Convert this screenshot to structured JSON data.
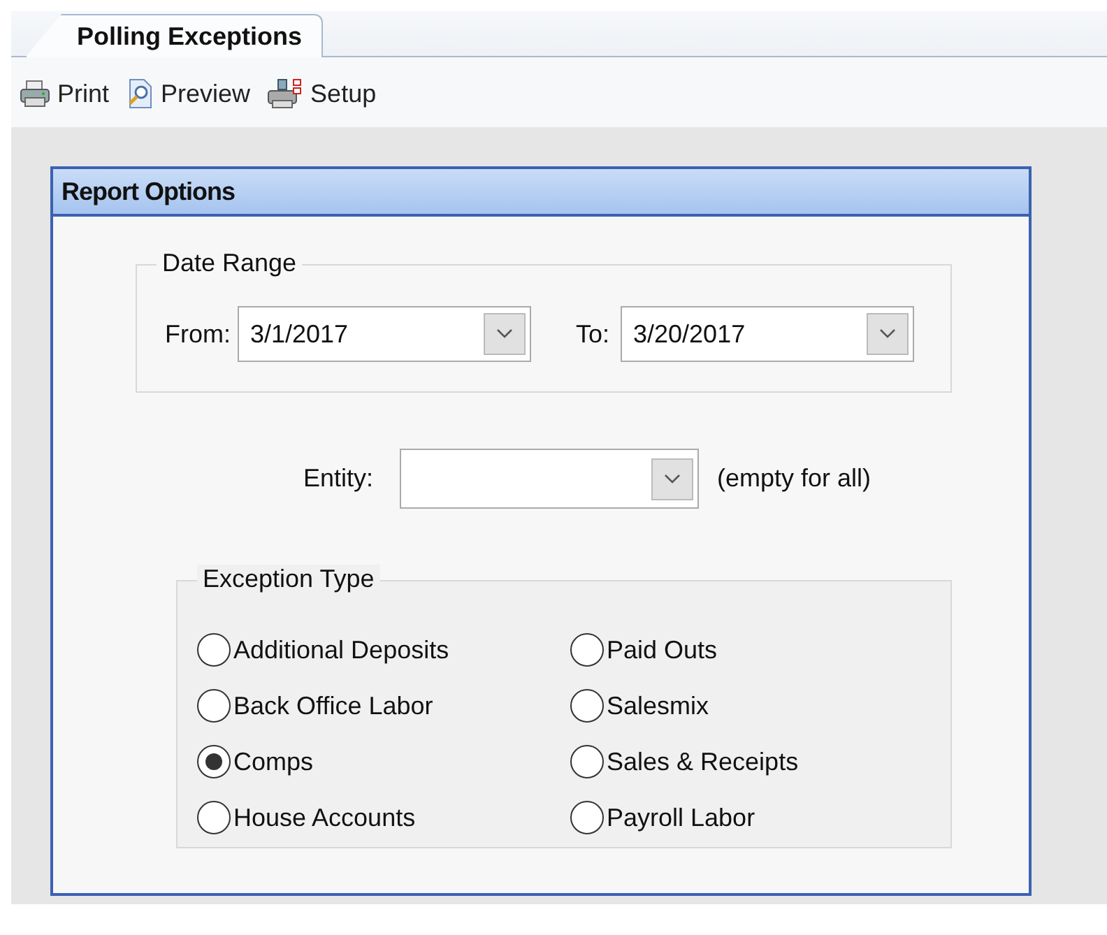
{
  "tabs": [
    {
      "label": "Polling Exceptions",
      "selected": true
    }
  ],
  "toolbar": [
    {
      "kind": "print",
      "label": "Print"
    },
    {
      "kind": "preview",
      "label": "Preview"
    },
    {
      "kind": "setup",
      "label": "Setup"
    }
  ],
  "panel": {
    "title": "Report Options",
    "date_range": {
      "legend": "Date Range",
      "from_label": "From:",
      "from_value": "3/1/2017",
      "to_label": "To:",
      "to_value": "3/20/2017"
    },
    "entity": {
      "label": "Entity:",
      "hint": "(empty for all)"
    },
    "exception_type": {
      "legend": "Exception Type",
      "options": [
        {
          "label": "Additional Deposits",
          "selected": false
        },
        {
          "label": "Back Office Labor",
          "selected": false
        },
        {
          "label": "Comps",
          "selected": true
        },
        {
          "label": "House Accounts",
          "selected": false
        },
        {
          "label": "Paid Outs",
          "selected": false
        },
        {
          "label": "Salesmix",
          "selected": false
        },
        {
          "label": "Sales & Receipts",
          "selected": false
        },
        {
          "label": "Payroll Labor",
          "selected": false
        }
      ]
    }
  }
}
